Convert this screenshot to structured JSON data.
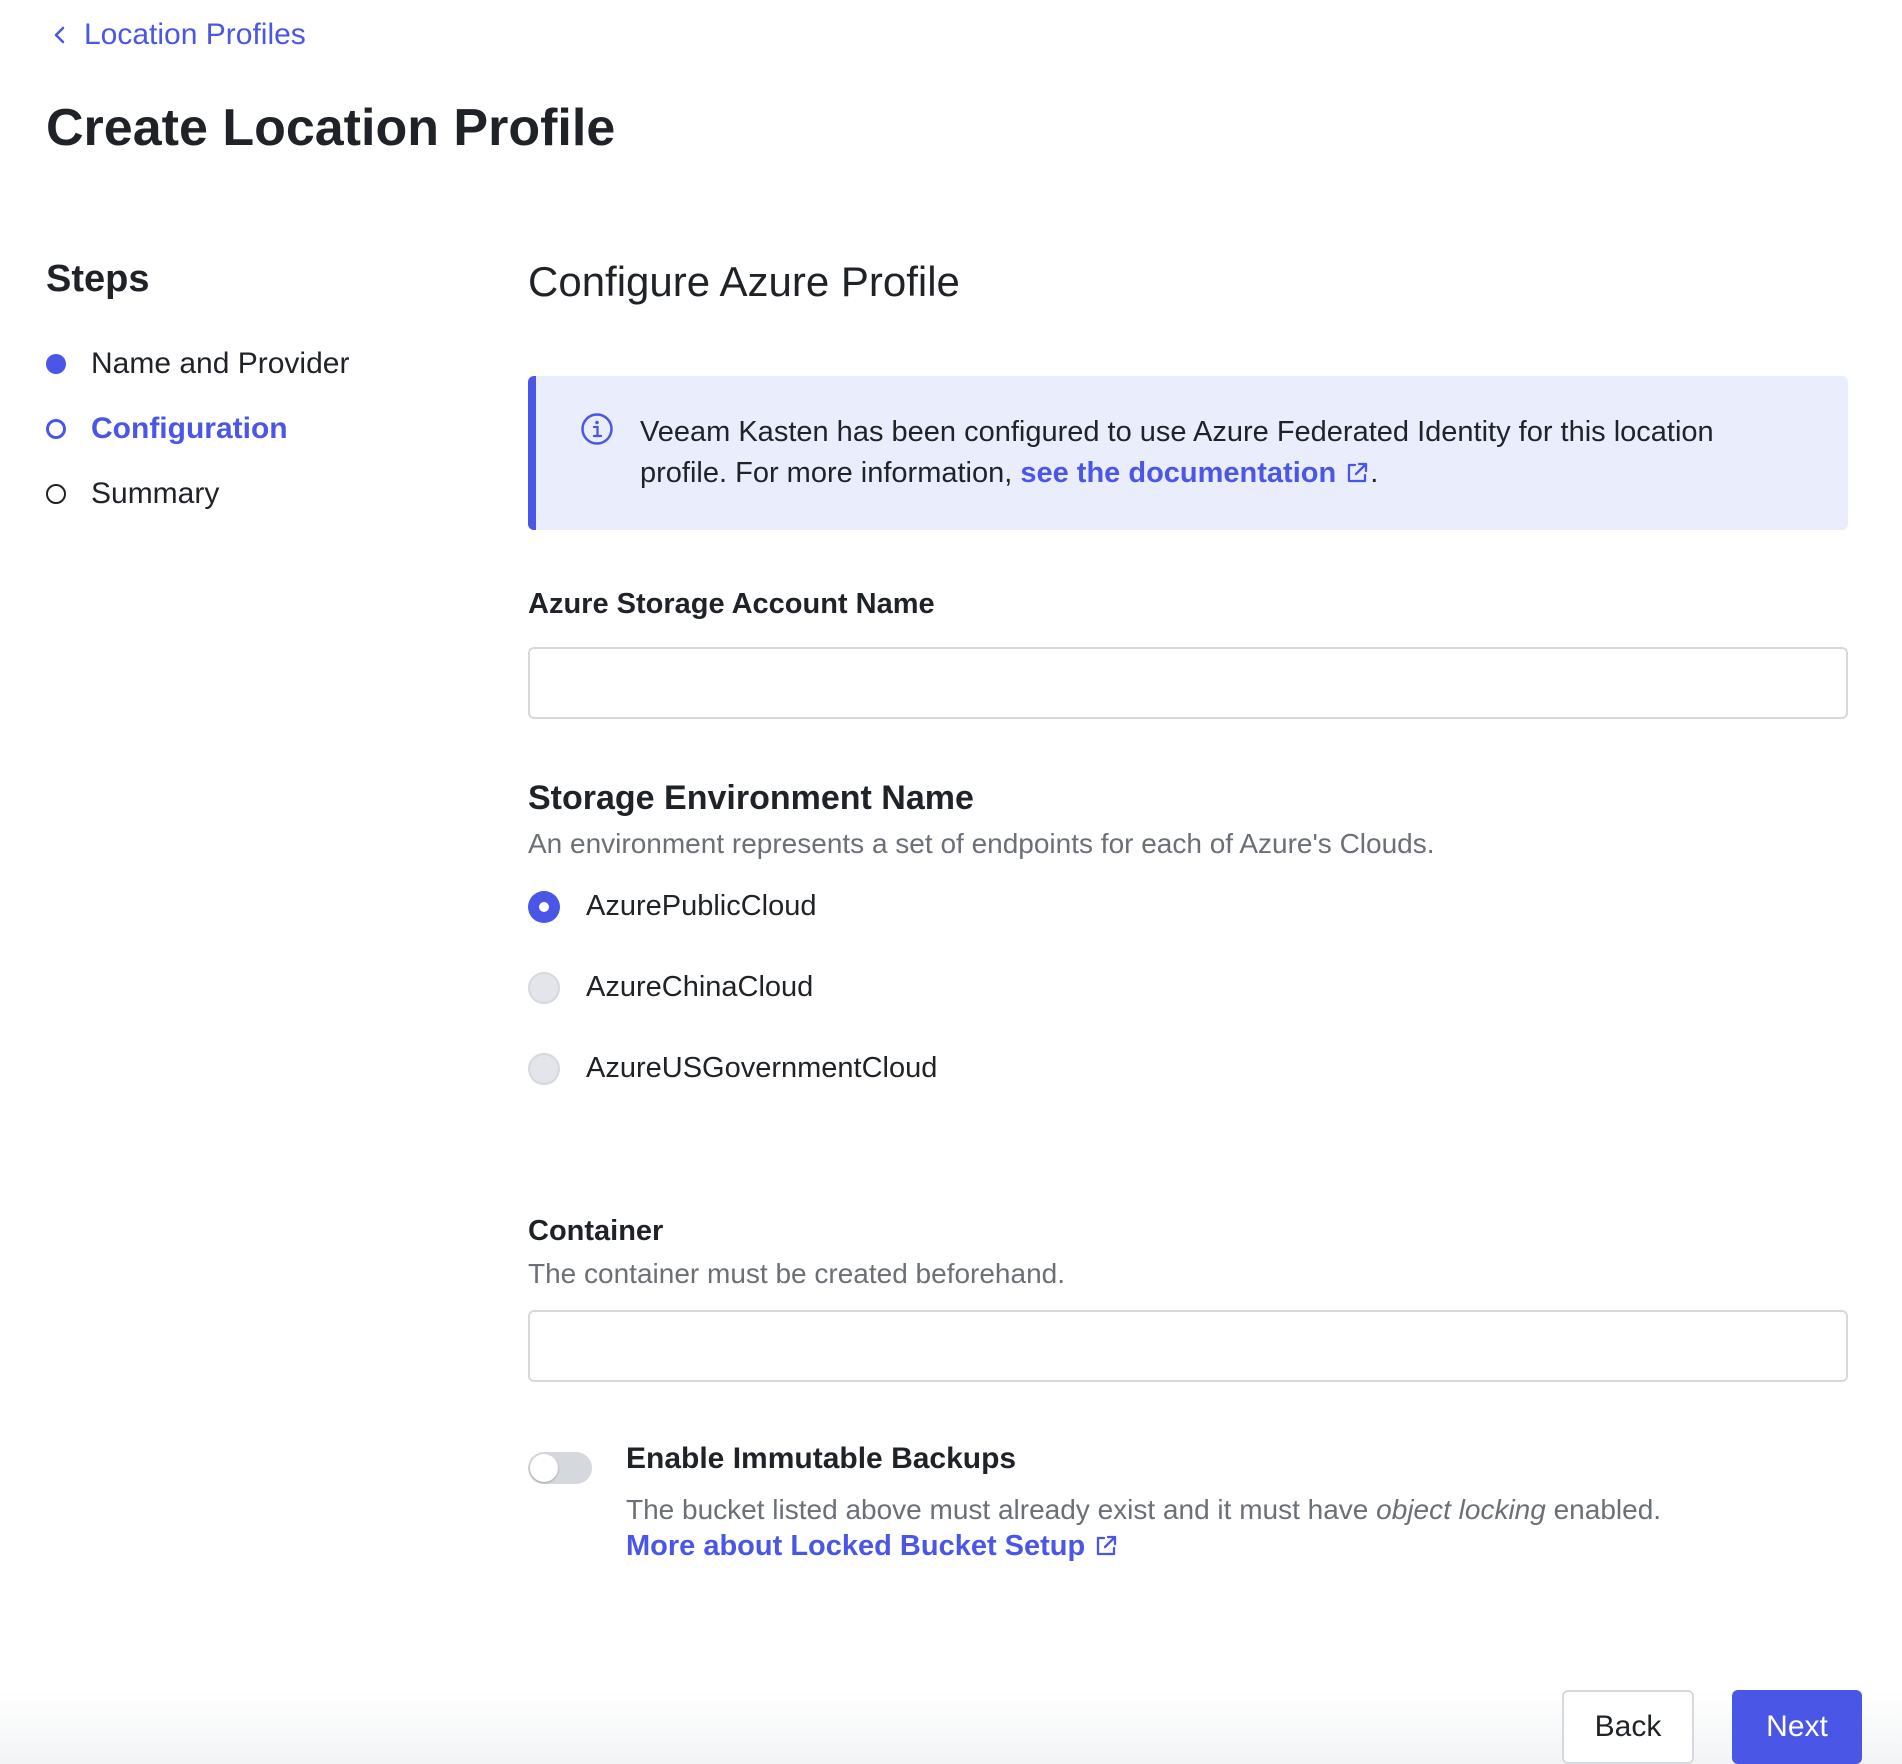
{
  "nav": {
    "back_label": "Location Profiles"
  },
  "page": {
    "title": "Create Location Profile"
  },
  "steps": {
    "title": "Steps",
    "items": [
      {
        "label": "Name and Provider",
        "state": "done"
      },
      {
        "label": "Configuration",
        "state": "current"
      },
      {
        "label": "Summary",
        "state": "todo"
      }
    ]
  },
  "main": {
    "title": "Configure Azure Profile",
    "info": {
      "text": "Veeam Kasten has been configured to use Azure Federated Identity for this location profile. For more information, ",
      "link_label": "see the documentation",
      "suffix": "."
    },
    "storage_account": {
      "label": "Azure Storage Account Name",
      "value": "",
      "placeholder": ""
    },
    "environment": {
      "label": "Storage Environment Name",
      "help": "An environment represents a set of endpoints for each of Azure's Clouds.",
      "options": [
        {
          "label": "AzurePublicCloud",
          "selected": true
        },
        {
          "label": "AzureChinaCloud",
          "selected": false
        },
        {
          "label": "AzureUSGovernmentCloud",
          "selected": false
        }
      ]
    },
    "container": {
      "label": "Container",
      "help": "The container must be created beforehand.",
      "value": "",
      "placeholder": ""
    },
    "immutable": {
      "label": "Enable Immutable Backups",
      "enabled": false,
      "desc_before": "The bucket listed above must already exist and it must have ",
      "desc_em": "object locking",
      "desc_after": " enabled.",
      "link_label": "More about Locked Bucket Setup"
    }
  },
  "footer": {
    "back_label": "Back",
    "next_label": "Next"
  },
  "colors": {
    "accent": "#4a57e6",
    "info_bg": "#eaedfc",
    "border": "#d5d8dd",
    "muted_text": "#6b7077"
  },
  "icons": {
    "back": "chevron-left-icon",
    "info": "info-circle-icon",
    "external": "external-link-icon"
  }
}
